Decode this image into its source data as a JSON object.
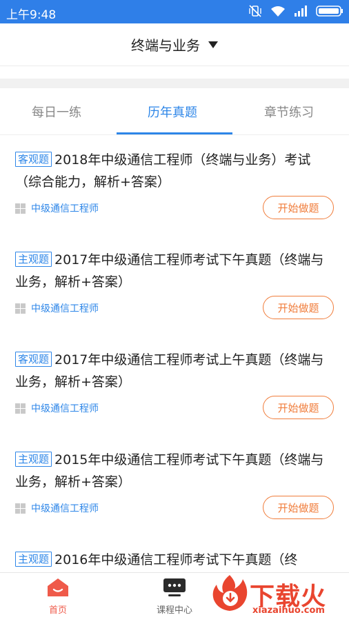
{
  "status_bar": {
    "time": "上午9:48"
  },
  "header": {
    "title": "终端与业务"
  },
  "tabs": [
    {
      "label": "每日一练"
    },
    {
      "label": "历年真题"
    },
    {
      "label": "章节练习"
    }
  ],
  "list": {
    "items": [
      {
        "tag": "客观题",
        "title": "2018年中级通信工程师（终端与业务）考试（综合能力，解析+答案）",
        "category": "中级通信工程师",
        "button": "开始做题"
      },
      {
        "tag": "主观题",
        "title": "2017年中级通信工程师考试下午真题（终端与业务，解析+答案）",
        "category": "中级通信工程师",
        "button": "开始做题"
      },
      {
        "tag": "客观题",
        "title": "2017年中级通信工程师考试上午真题（终端与业务，解析+答案）",
        "category": "中级通信工程师",
        "button": "开始做题"
      },
      {
        "tag": "主观题",
        "title": "2015年中级通信工程师考试下午真题（终端与业务，解析+答案）",
        "category": "中级通信工程师",
        "button": "开始做题"
      },
      {
        "tag": "主观题",
        "title": "2016年中级通信工程师考试下午真题（终",
        "category": "",
        "button": ""
      }
    ]
  },
  "bottom_nav": {
    "home": "首页",
    "course": "课程中心"
  },
  "watermark": {
    "text": "下载火",
    "url": "xiazaihuo.com"
  },
  "colors": {
    "status_bar": "#2f7fe8",
    "accent": "#2d86e8",
    "button": "#f07c3a",
    "home": "#ef5a4a"
  }
}
